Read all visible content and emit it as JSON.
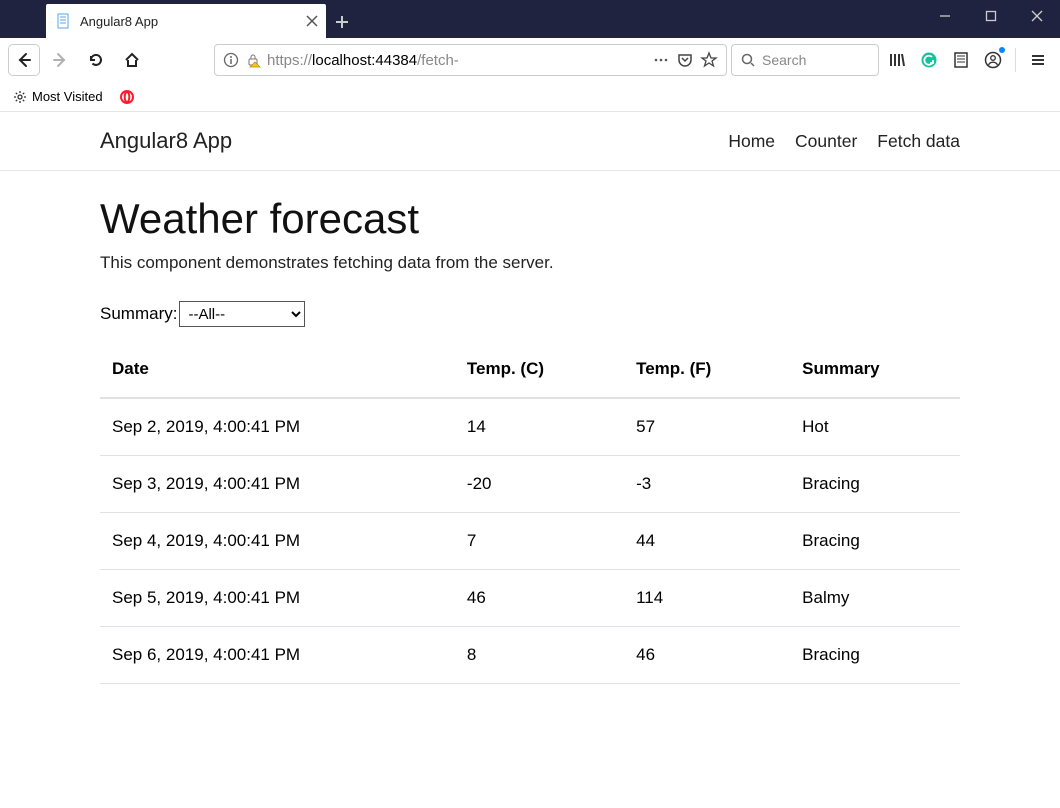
{
  "window": {
    "tab_title": "Angular8 App",
    "url_scheme": "https://",
    "url_host": "localhost",
    "url_port": ":44384",
    "url_path": "/fetch-",
    "search_placeholder": "Search",
    "bookmark_most_visited": "Most Visited"
  },
  "app": {
    "brand": "Angular8 App",
    "nav_home": "Home",
    "nav_counter": "Counter",
    "nav_fetch": "Fetch data"
  },
  "page": {
    "title": "Weather forecast",
    "description": "This component demonstrates fetching data from the server.",
    "filter_label": "Summary:",
    "filter_option_all": "--All--"
  },
  "table": {
    "headers": {
      "date": "Date",
      "tempC": "Temp. (C)",
      "tempF": "Temp. (F)",
      "summary": "Summary"
    },
    "rows": [
      {
        "date": "Sep 2, 2019, 4:00:41 PM",
        "tempC": "14",
        "tempF": "57",
        "summary": "Hot"
      },
      {
        "date": "Sep 3, 2019, 4:00:41 PM",
        "tempC": "-20",
        "tempF": "-3",
        "summary": "Bracing"
      },
      {
        "date": "Sep 4, 2019, 4:00:41 PM",
        "tempC": "7",
        "tempF": "44",
        "summary": "Bracing"
      },
      {
        "date": "Sep 5, 2019, 4:00:41 PM",
        "tempC": "46",
        "tempF": "114",
        "summary": "Balmy"
      },
      {
        "date": "Sep 6, 2019, 4:00:41 PM",
        "tempC": "8",
        "tempF": "46",
        "summary": "Bracing"
      }
    ]
  }
}
